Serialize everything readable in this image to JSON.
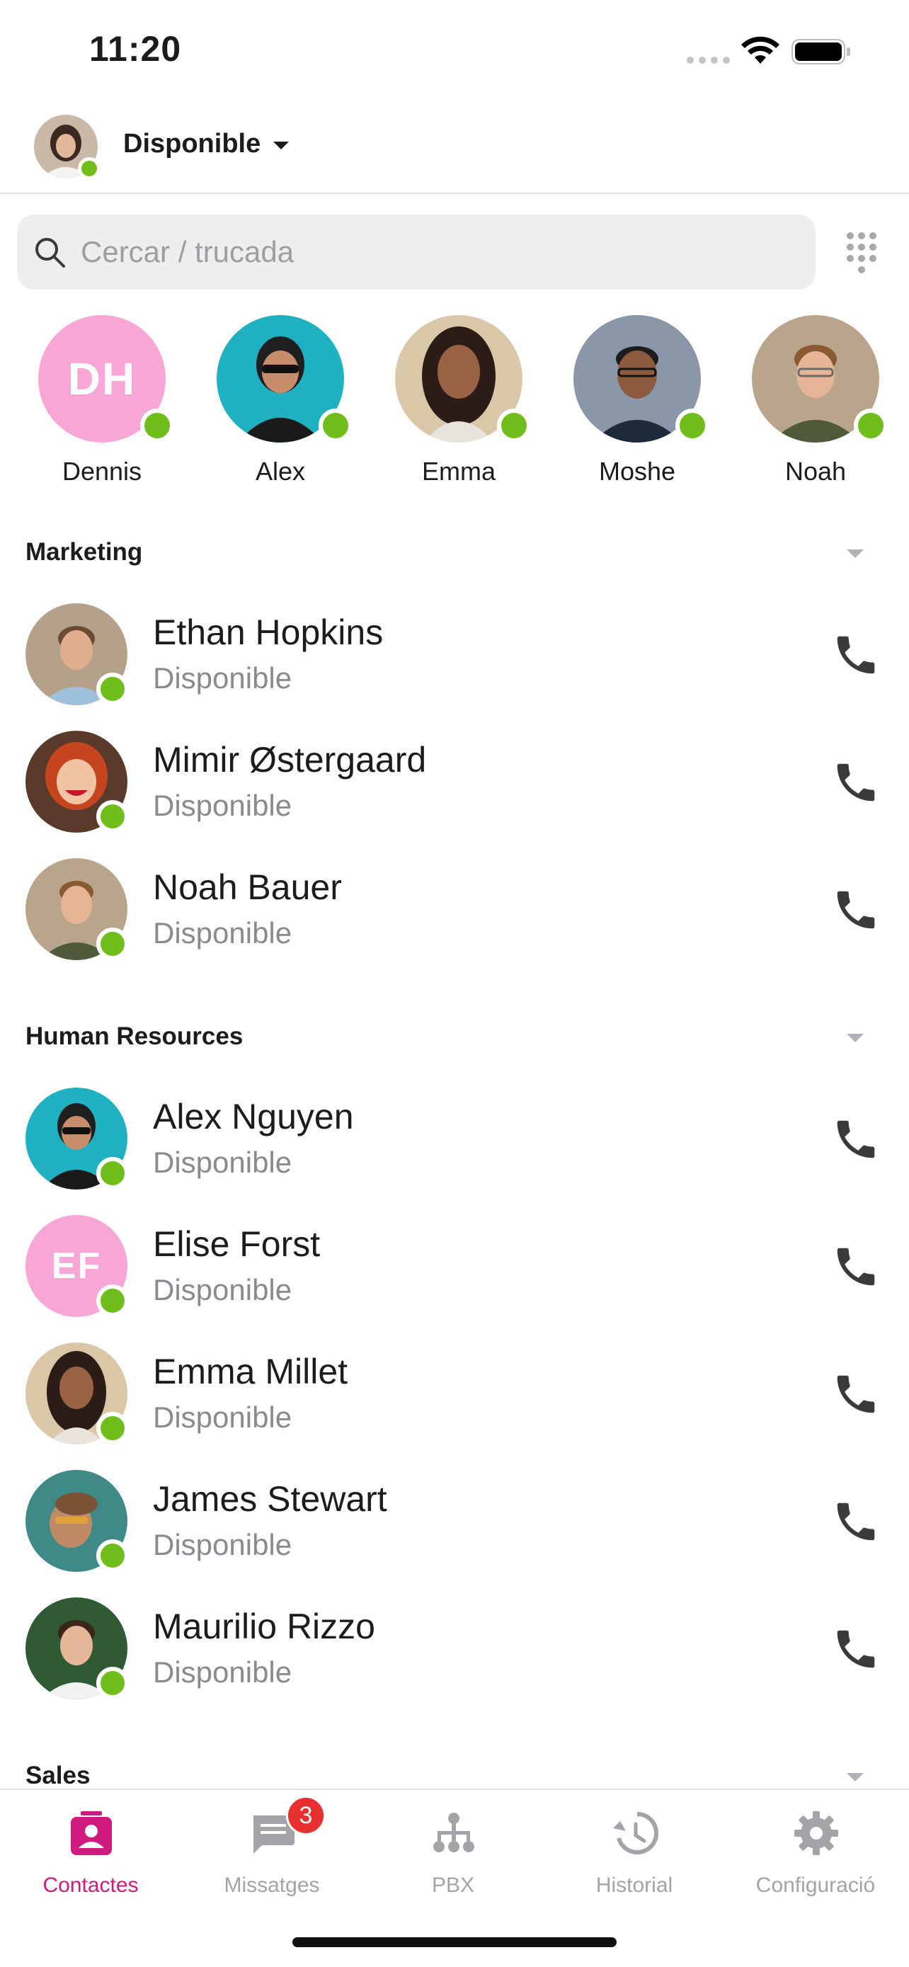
{
  "status_bar": {
    "time": "11:20"
  },
  "presence": {
    "label": "Disponible"
  },
  "search": {
    "placeholder": "Cercar / trucada"
  },
  "favorites": [
    {
      "name": "Dennis",
      "initials": "DH"
    },
    {
      "name": "Alex"
    },
    {
      "name": "Emma"
    },
    {
      "name": "Moshe"
    },
    {
      "name": "Noah"
    }
  ],
  "groups": [
    {
      "title": "Marketing",
      "contacts": [
        {
          "name": "Ethan Hopkins",
          "status": "Disponible"
        },
        {
          "name": "Mimir Østergaard",
          "status": "Disponible"
        },
        {
          "name": "Noah Bauer",
          "status": "Disponible"
        }
      ]
    },
    {
      "title": "Human Resources",
      "contacts": [
        {
          "name": "Alex Nguyen",
          "status": "Disponible"
        },
        {
          "name": "Elise Forst",
          "status": "Disponible",
          "initials": "EF"
        },
        {
          "name": "Emma Millet",
          "status": "Disponible"
        },
        {
          "name": "James Stewart",
          "status": "Disponible"
        },
        {
          "name": "Maurilio Rizzo",
          "status": "Disponible"
        }
      ]
    },
    {
      "title": "Sales",
      "contacts": []
    }
  ],
  "tabs": [
    {
      "label": "Contactes",
      "icon": "contacts-icon",
      "active": true
    },
    {
      "label": "Missatges",
      "icon": "messages-icon",
      "badge": "3"
    },
    {
      "label": "PBX",
      "icon": "pbx-icon"
    },
    {
      "label": "Historial",
      "icon": "history-icon"
    },
    {
      "label": "Configuració",
      "icon": "settings-icon"
    }
  ],
  "colors": {
    "accent": "#d11a7d",
    "online": "#6fbe1c",
    "badge": "#ea2f2f",
    "initials_bg": "#f7a6d6",
    "inactive_tab": "#a4a4a8"
  }
}
